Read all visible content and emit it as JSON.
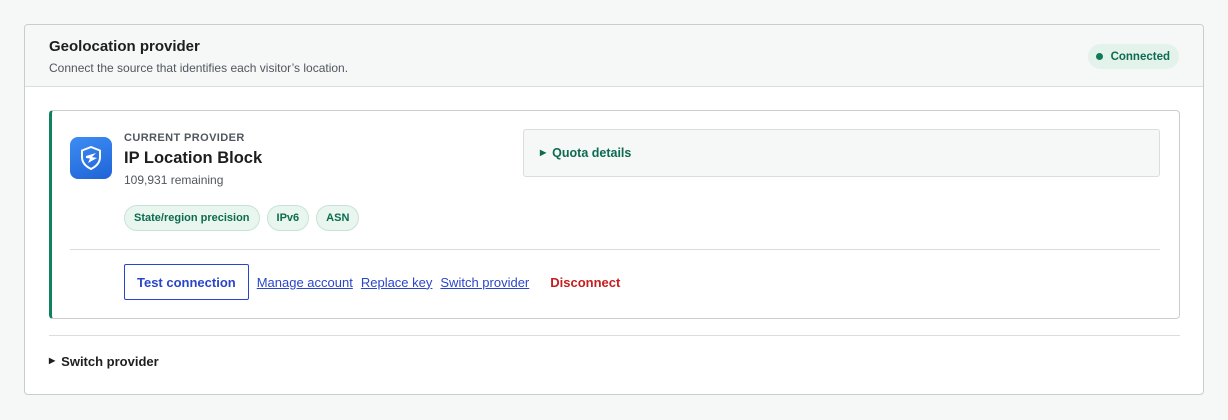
{
  "panel": {
    "title": "Geolocation provider",
    "subtitle": "Connect the source that identifies each visitor’s location.",
    "status": "Connected"
  },
  "provider": {
    "eyebrow": "CURRENT PROVIDER",
    "name": "IP Location Block",
    "remaining": "109,931 remaining",
    "logo_icon": "shield-icon",
    "tags": [
      "State/region precision",
      "IPv6",
      "ASN"
    ]
  },
  "quota": {
    "label": "Quota details"
  },
  "actions": {
    "test": "Test connection",
    "manage": "Manage account",
    "replace": "Replace key",
    "switch": "Switch provider",
    "disconnect": "Disconnect"
  },
  "switch_section": {
    "label": "Switch provider"
  },
  "colors": {
    "accent": "#108060",
    "link": "#2a46c8",
    "danger": "#c41e1e",
    "badge_bg": "#e4f2ec"
  }
}
